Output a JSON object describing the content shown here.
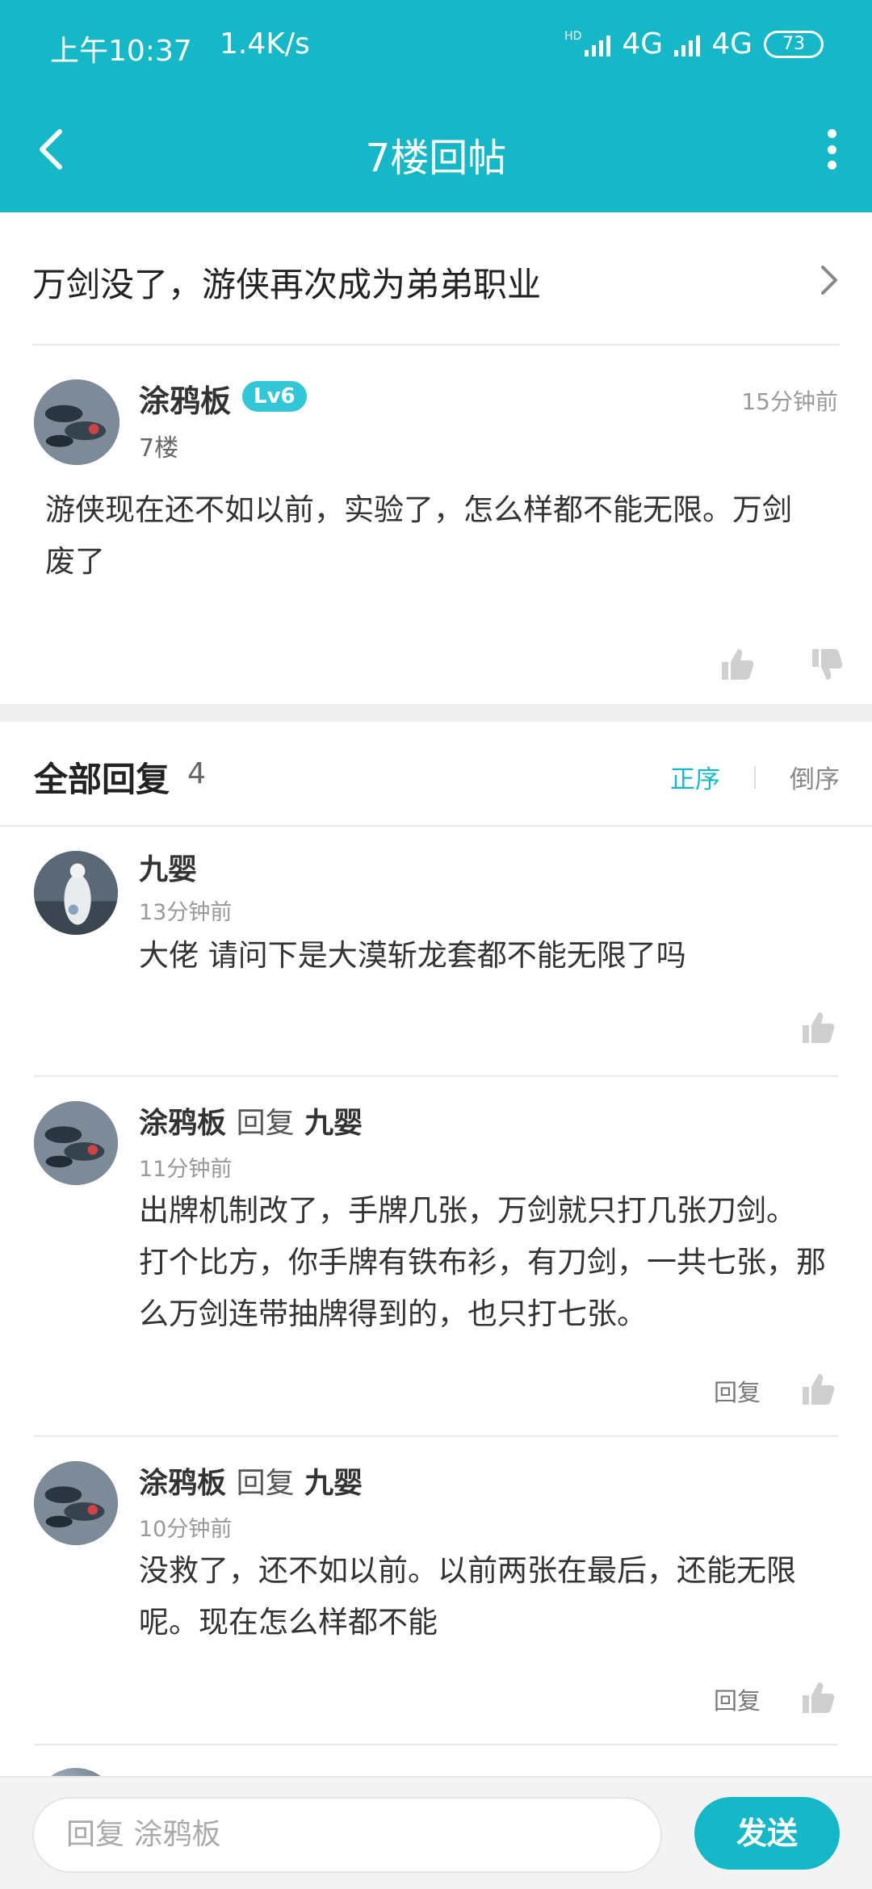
{
  "status_bar": {
    "time": "上午10:37",
    "speed": "1.4K/s",
    "hd": "HD",
    "net1": "4G",
    "net2": "4G",
    "battery": "73"
  },
  "header": {
    "title": "7楼回帖"
  },
  "thread": {
    "title": "万剑没了，游侠再次成为弟弟职业"
  },
  "post": {
    "author": "涂鸦板",
    "level": "Lv6",
    "floor": "7楼",
    "time": "15分钟前",
    "content_line1": "游侠现在还不如以前，实验了，怎么样都不能无限。万剑",
    "content_line2": "废了"
  },
  "replies_header": {
    "label": "全部回复",
    "count": "4",
    "sort_asc": "正序",
    "sort_desc": "倒序"
  },
  "replies": [
    {
      "author": "九婴",
      "time": "13分钟前",
      "lines": [
        "大佬   请问下是大漠斩龙套都不能无限了吗"
      ]
    },
    {
      "author": "涂鸦板",
      "reply_word": "回复",
      "reply_to": "九婴",
      "time": "11分钟前",
      "lines": [
        "出牌机制改了，手牌几张，万剑就只打几张刀剑。",
        "打个比方，你手牌有铁布衫，有刀剑，一共七张，那",
        "么万剑连带抽牌得到的，也只打七张。"
      ],
      "reply_label": "回复"
    },
    {
      "author": "涂鸦板",
      "reply_word": "回复",
      "reply_to": "九婴",
      "time": "10分钟前",
      "lines": [
        "没救了，还不如以前。以前两张在最后，还能无限",
        "呢。现在怎么样都不能"
      ],
      "reply_label": "回复"
    }
  ],
  "composer": {
    "placeholder": "回复 涂鸦板",
    "send": "发送"
  },
  "colors": {
    "accent": "#16b8c8",
    "level_badge": "#33c6d6"
  },
  "icons": [
    "back-icon",
    "more-icon",
    "chevron-right-icon",
    "thumb-up-icon",
    "thumb-down-icon"
  ]
}
